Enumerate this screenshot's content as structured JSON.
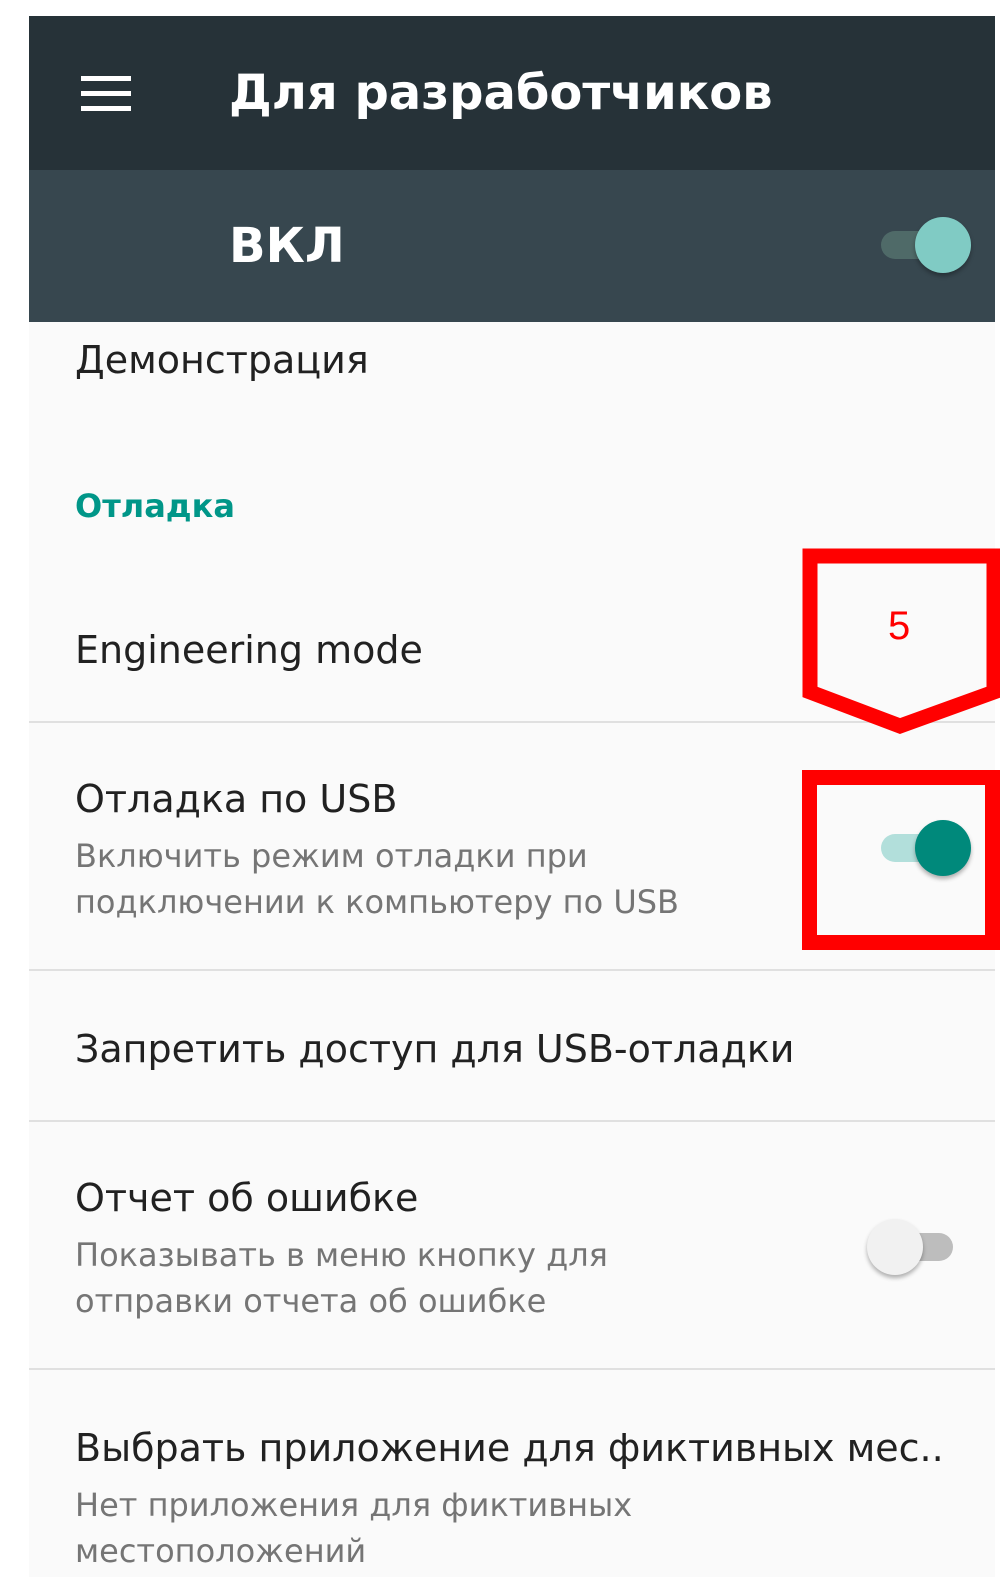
{
  "toolbar": {
    "title": "Для разработчиков",
    "menu_icon": "hamburger-menu-icon"
  },
  "master_switch": {
    "label": "ВКЛ",
    "state": "on"
  },
  "items": {
    "demo": {
      "title": "Демонстрация"
    },
    "section_debug": {
      "title": "Отладка"
    },
    "engineering": {
      "title": "Engineering mode"
    },
    "usb_debug": {
      "title": "Отладка по USB",
      "summary_line1": "Включить режим отладки при",
      "summary_line2": "подключении к компьютеру по USB",
      "state": "on"
    },
    "revoke": {
      "title": "Запретить доступ для USB-отладки"
    },
    "bug_report": {
      "title": "Отчет об ошибке",
      "summary_line1": "Показывать в меню кнопку для",
      "summary_line2": "отправки отчета об ошибке",
      "state": "off"
    },
    "mock_location": {
      "title": "Выбрать приложение для фиктивных мес..",
      "summary_line1": "Нет приложения для фиктивных",
      "summary_line2": "местоположений"
    }
  },
  "annotation": {
    "step_number": "5",
    "color": "#ff0000"
  },
  "colors": {
    "toolbar": "#263238",
    "master_bar": "#37474f",
    "accent": "#009688",
    "accent_light": "#80cbc4"
  }
}
